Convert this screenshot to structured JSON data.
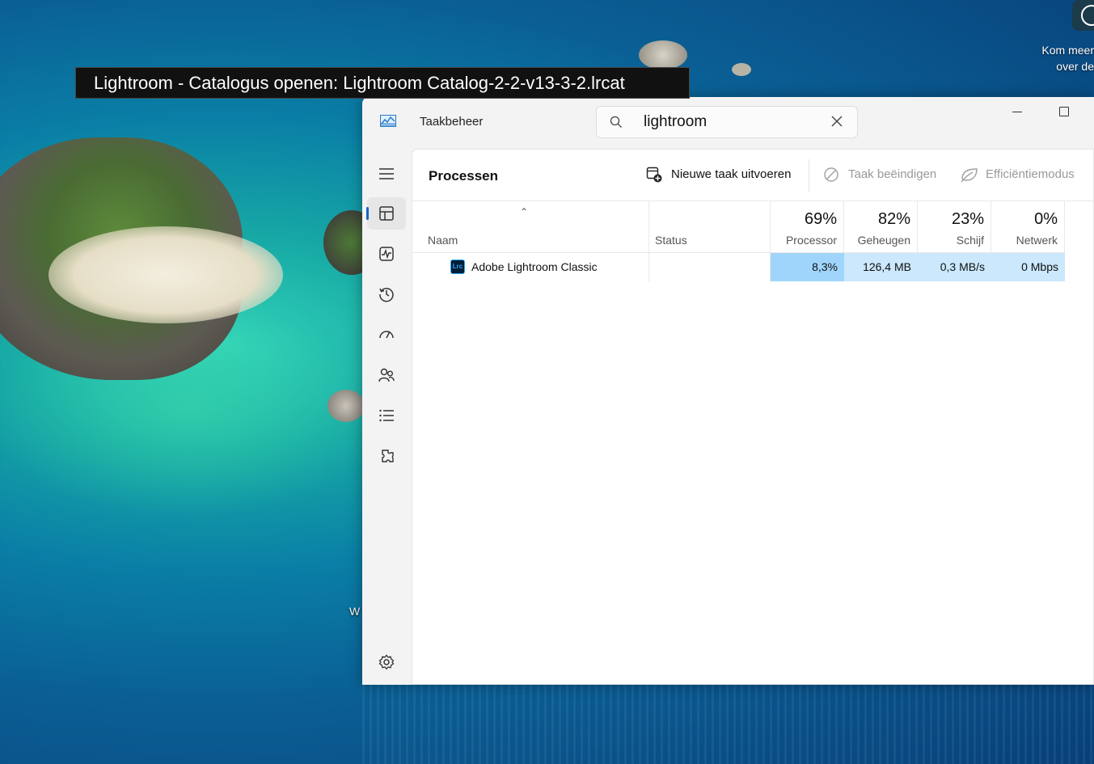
{
  "tooltip": {
    "text": "Lightroom - Catalogus openen: Lightroom Catalog-2-2-v13-3-2.lrcat"
  },
  "desktop_widget": {
    "line1": "Kom meer",
    "line2": "over de"
  },
  "desktop_item": {
    "label": "W"
  },
  "window": {
    "title": "Taakbeheer",
    "search": {
      "value": "lightroom",
      "placeholder": ""
    }
  },
  "sidebar": {
    "items": [
      {
        "name": "hamburger-menu",
        "icon": "menu-icon",
        "active": false
      },
      {
        "name": "processen",
        "icon": "processes-icon",
        "active": true
      },
      {
        "name": "prestaties",
        "icon": "performance-icon",
        "active": false
      },
      {
        "name": "app-geschiedenis",
        "icon": "history-icon",
        "active": false
      },
      {
        "name": "opstart-apps",
        "icon": "startup-icon",
        "active": false
      },
      {
        "name": "gebruikers",
        "icon": "users-icon",
        "active": false
      },
      {
        "name": "details",
        "icon": "details-list-icon",
        "active": false
      },
      {
        "name": "services",
        "icon": "services-icon",
        "active": false
      },
      {
        "name": "instellingen",
        "icon": "settings-icon",
        "active": false
      }
    ]
  },
  "toolbar": {
    "page_title": "Processen",
    "new_task": "Nieuwe taak uitvoeren",
    "end_task": "Taak beëindigen",
    "efficiency": "Efficiëntiemodus"
  },
  "table": {
    "columns": {
      "name": {
        "label": "Naam"
      },
      "status": {
        "label": "Status"
      },
      "cpu": {
        "pct": "69%",
        "label": "Processor"
      },
      "memory": {
        "pct": "82%",
        "label": "Geheugen"
      },
      "disk": {
        "pct": "23%",
        "label": "Schijf"
      },
      "network": {
        "pct": "0%",
        "label": "Netwerk"
      }
    },
    "rows": [
      {
        "icon_text": "Lrc",
        "name": "Adobe Lightroom Classic",
        "status": "",
        "cpu": "8,3%",
        "memory": "126,4 MB",
        "disk": "0,3 MB/s",
        "network": "0 Mbps"
      }
    ]
  },
  "colors": {
    "accent": "#1a62c4",
    "heat_cpu": "#9fd5fb",
    "heat_other": "#cbe8fd"
  }
}
